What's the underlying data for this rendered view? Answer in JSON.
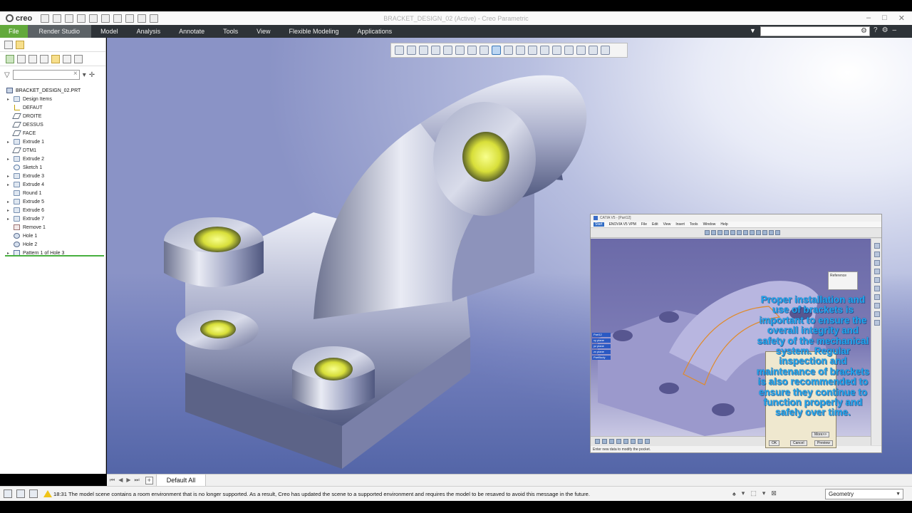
{
  "app": {
    "logo": "creo",
    "window_title": "BRACKET_DESIGN_02 (Active) - Creo Parametric"
  },
  "ribbon": {
    "tabs": [
      "File",
      "Render Studio",
      "Model",
      "Analysis",
      "Annotate",
      "Tools",
      "View",
      "Flexible Modeling",
      "Applications"
    ],
    "active_tab": "Render Studio",
    "search_placeholder": ""
  },
  "model_tree": {
    "root": "BRACKET_DESIGN_02.PRT",
    "items": [
      {
        "label": "Design Items",
        "icon": "folder-icon",
        "expandable": true
      },
      {
        "label": "DEFAUT",
        "icon": "csys-icon",
        "expandable": false
      },
      {
        "label": "DROITE",
        "icon": "datum-plane-icon",
        "expandable": false
      },
      {
        "label": "DESSUS",
        "icon": "datum-plane-icon",
        "expandable": false
      },
      {
        "label": "FACE",
        "icon": "datum-plane-icon",
        "expandable": false
      },
      {
        "label": "Extrude 1",
        "icon": "extrude-icon",
        "expandable": true
      },
      {
        "label": "DTM1",
        "icon": "datum-plane-icon",
        "expandable": false
      },
      {
        "label": "Extrude 2",
        "icon": "extrude-icon",
        "expandable": true
      },
      {
        "label": "Sketch 1",
        "icon": "sketch-icon",
        "expandable": false
      },
      {
        "label": "Extrude 3",
        "icon": "extrude-icon",
        "expandable": true
      },
      {
        "label": "Extrude 4",
        "icon": "extrude-icon",
        "expandable": true
      },
      {
        "label": "Round 1",
        "icon": "round-icon",
        "expandable": false
      },
      {
        "label": "Extrude 5",
        "icon": "extrude-icon",
        "expandable": true
      },
      {
        "label": "Extrude 6",
        "icon": "extrude-icon",
        "expandable": true
      },
      {
        "label": "Extrude 7",
        "icon": "extrude-icon",
        "expandable": true
      },
      {
        "label": "Remove 1",
        "icon": "remove-icon",
        "expandable": false
      },
      {
        "label": "Hole 1",
        "icon": "hole-icon",
        "expandable": false
      },
      {
        "label": "Hole 2",
        "icon": "hole-icon",
        "expandable": false
      },
      {
        "label": "Pattern 1 of Hole 3",
        "icon": "pattern-icon",
        "expandable": true
      }
    ]
  },
  "catia_overlay": {
    "title": "CATIA V5 - [Part12]",
    "menus": [
      "Start",
      "ENOVIA V5 VPM",
      "File",
      "Edit",
      "View",
      "Insert",
      "Tools",
      "Window",
      "Help"
    ],
    "status": "Enter new data to modify the pocket.",
    "reference_label": "Reference",
    "dialog_buttons": {
      "more": "More>>",
      "ok": "OK",
      "cancel": "Cancel",
      "preview": "Preview"
    },
    "spec_tree": [
      "Part12",
      "xy plane",
      "yz plane",
      "zx plane",
      "PartBody"
    ],
    "caption": "Proper installation and use of brackets is important to ensure the overall integrity and safety of the mechanical system. Regular inspection and maintenance of brackets is also recommended to ensure they continue to function properly and safely over time."
  },
  "bottom_tabs": {
    "active": "Default All"
  },
  "status_bar": {
    "time": "18:31",
    "message": "The model scene contains a room environment that is no longer supported.  As a result, Creo has updated the scene to a supported environment and requires the model to be resaved to avoid this message in the future.",
    "filter_value": "Geometry"
  },
  "colors": {
    "file_tab": "#62a93b",
    "ribbon_bg": "#2e3338",
    "overlay_text": "#22a7ef",
    "hole_highlight": "#d8df3a"
  }
}
